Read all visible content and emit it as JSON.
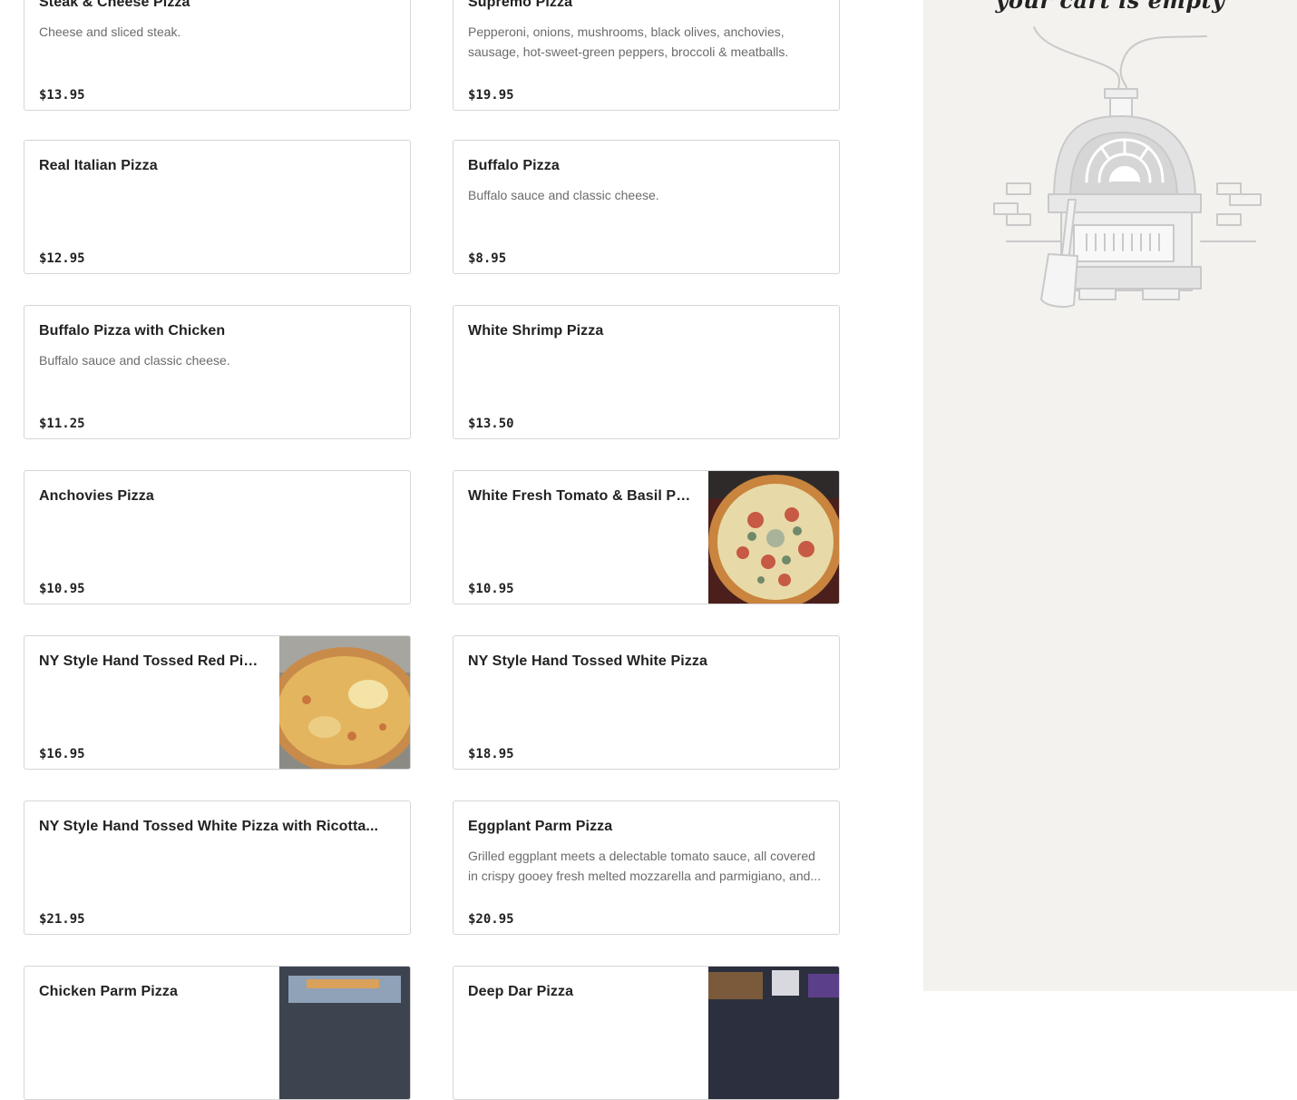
{
  "menu": {
    "items": [
      {
        "name": "Steak & Cheese Pizza",
        "description": "Cheese and sliced steak.",
        "price": "$13.95",
        "image": false
      },
      {
        "name": "Supremo Pizza",
        "description": "Pepperoni, onions, mushrooms, black olives, anchovies, sausage, hot-sweet-green peppers, broccoli & meatballs.",
        "price": "$19.95",
        "image": false
      },
      {
        "name": "Real Italian Pizza",
        "description": "",
        "price": "$12.95",
        "image": false
      },
      {
        "name": "Buffalo Pizza",
        "description": "Buffalo sauce and classic cheese.",
        "price": "$8.95",
        "image": false
      },
      {
        "name": "Buffalo Pizza with Chicken",
        "description": "Buffalo sauce and classic cheese.",
        "price": "$11.25",
        "image": false
      },
      {
        "name": "White Shrimp Pizza",
        "description": "",
        "price": "$13.50",
        "image": false
      },
      {
        "name": "Anchovies Pizza",
        "description": "",
        "price": "$10.95",
        "image": false
      },
      {
        "name": "White Fresh Tomato & Basil Pizza",
        "description": "",
        "price": "$10.95",
        "image": true
      },
      {
        "name": "NY Style Hand Tossed Red Pizza",
        "description": "",
        "price": "$16.95",
        "image": true
      },
      {
        "name": "NY Style Hand Tossed White Pizza",
        "description": "",
        "price": "$18.95",
        "image": false
      },
      {
        "name": "NY Style Hand Tossed White Pizza with Ricotta...",
        "description": "",
        "price": "$21.95",
        "image": false
      },
      {
        "name": "Eggplant Parm Pizza",
        "description": "Grilled eggplant meets a delectable tomato sauce, all covered in crispy gooey fresh melted mozzarella and parmigiano, and...",
        "price": "$20.95",
        "image": false
      },
      {
        "name": "Chicken Parm Pizza",
        "description": "",
        "price": "",
        "image": true
      },
      {
        "name": "Deep Dar Pizza",
        "description": "",
        "price": "",
        "image": true
      }
    ]
  },
  "cart": {
    "title": "your cart is empty",
    "illustration": "pizza-oven-illustration"
  },
  "colors": {
    "card_border": "#d6d6d6",
    "cart_background": "#f3f2ef",
    "description_text": "#6b6b6b"
  }
}
